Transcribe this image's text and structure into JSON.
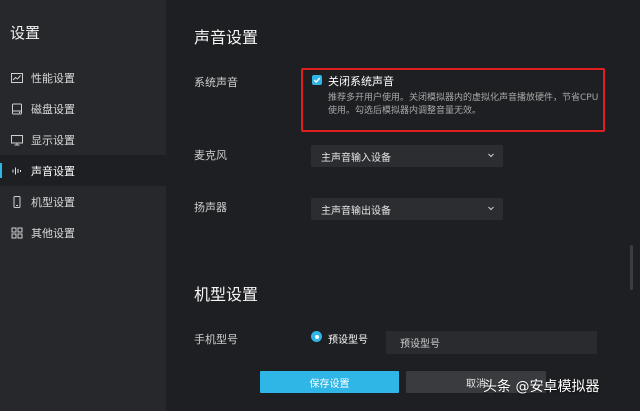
{
  "sidebar": {
    "title": "设置",
    "items": [
      {
        "label": "性能设置",
        "icon": "chart-icon"
      },
      {
        "label": "磁盘设置",
        "icon": "disk-icon"
      },
      {
        "label": "显示设置",
        "icon": "monitor-icon"
      },
      {
        "label": "声音设置",
        "icon": "sound-icon",
        "active": true
      },
      {
        "label": "机型设置",
        "icon": "phone-icon"
      },
      {
        "label": "其他设置",
        "icon": "grid-icon"
      }
    ]
  },
  "sound": {
    "title": "声音设置",
    "system_sound_label": "系统声音",
    "mute_checkbox_label": "关闭系统声音",
    "mute_checked": true,
    "mute_description": "推荐多开用户使用。关闭模拟器内的虚拟化声音播放硬件，节省CPU使用。勾选后模拟器内调整音量无效。",
    "mic_label": "麦克风",
    "mic_value": "主声音输入设备",
    "speaker_label": "扬声器",
    "speaker_value": "主声音输出设备"
  },
  "model": {
    "title": "机型设置",
    "phone_model_label": "手机型号",
    "preset_radio_label": "预设型号",
    "preset_value": "预设型号"
  },
  "footer": {
    "save_label": "保存设置",
    "cancel_label": "取消"
  },
  "watermark": "头条 @安卓模拟器",
  "colors": {
    "accent": "#2fb5e6",
    "highlight_border": "#e02020",
    "background": "#1e1f22",
    "sidebar": "#27282b"
  }
}
